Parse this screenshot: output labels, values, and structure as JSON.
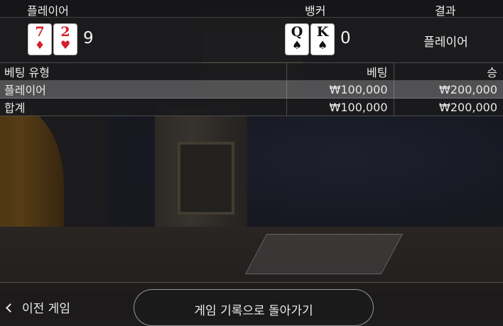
{
  "header": {
    "player": "플레이어",
    "banker": "뱅커",
    "result": "결과"
  },
  "hands": {
    "player": {
      "cards": [
        {
          "rank": "7",
          "suit": "♦",
          "color": "#d41f2b"
        },
        {
          "rank": "2",
          "suit": "♥",
          "color": "#d41f2b"
        }
      ],
      "score": "9"
    },
    "banker": {
      "cards": [
        {
          "rank": "Q",
          "suit": "♠",
          "color": "#111111"
        },
        {
          "rank": "K",
          "suit": "♠",
          "color": "#111111"
        }
      ],
      "score": "0"
    },
    "result": "플레이어"
  },
  "bets": {
    "columns": [
      "베팅 유형",
      "베팅",
      "승"
    ],
    "rows": [
      [
        "플레이어",
        "₩100,000",
        "₩200,000"
      ],
      [
        "합계",
        "₩100,000",
        "₩200,000"
      ]
    ]
  },
  "footer": {
    "prev_label": "이전 게임",
    "back_label": "게임 기록으로 돌아가기"
  },
  "icons": {
    "prev": "chevron-left-icon"
  }
}
